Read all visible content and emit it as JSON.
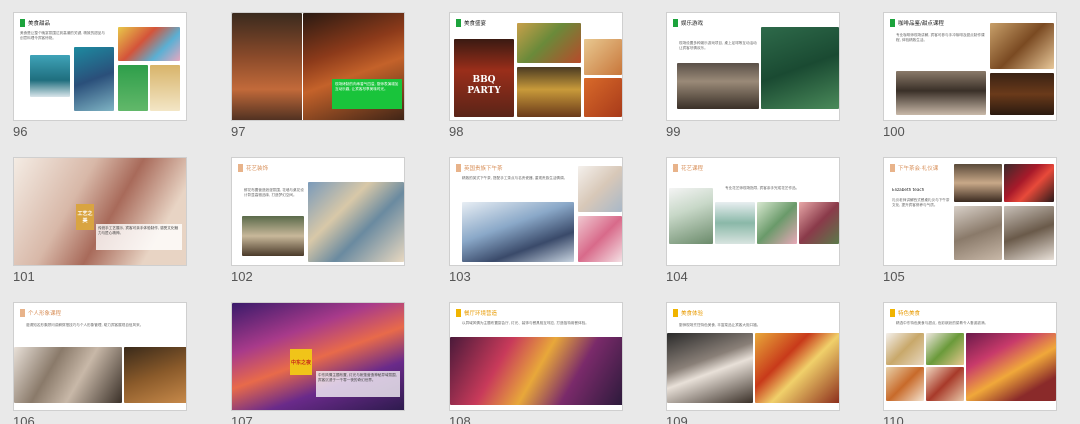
{
  "slides": [
    {
      "number": "96",
      "title": "美食甜品",
      "accent": "#1ca33c",
      "body": "美食是让整个晚宴氛围达到高潮的关键, 精致的甜品与创意料理令宾客惊艳。"
    },
    {
      "number": "97",
      "title": "",
      "accent": "#19c43b",
      "body": "现场烤制的肉串香气四溢, 厨师表演增加互动乐趣, 让宾客尽享美味时光。"
    },
    {
      "number": "98",
      "title": "美食盛宴",
      "accent": "#1ca33c",
      "body": "",
      "badge": "BBQ PARTY"
    },
    {
      "number": "99",
      "title": "娱乐游戏",
      "accent": "#1ca33c",
      "body": "现场设置多种娱乐游戏项目, 桌上足球等互动活动让宾客尽情欢乐。"
    },
    {
      "number": "100",
      "title": "咖啡品鉴/甜点课程",
      "accent": "#1ca33c",
      "body": "专业咖啡师现场讲解, 宾客可参与手冲咖啡及甜点制作课程, 体验精致生活。"
    },
    {
      "number": "101",
      "title": "",
      "accent": "#d9a441",
      "body": "传统手工艺展示, 宾客可亲手体验制作, 感受文化魅力与匠心精神。",
      "badge": "工艺之美"
    },
    {
      "number": "102",
      "title": "花艺装饰",
      "accent": "#e8b38a",
      "body": "鲜花布置营造浪漫氛围, 花墙与桌花设计彰显高雅品味, 打造梦幻空间。"
    },
    {
      "number": "103",
      "title": "英国贵族下午茶",
      "accent": "#e8b38a",
      "body": "精致的英式下午茶, 搭配手工茶点与名贵瓷器, 重现贵族生活情调。"
    },
    {
      "number": "104",
      "title": "花艺课程",
      "accent": "#e8b38a",
      "body": "专业花艺师现场指导, 宾客亲手完成花艺作品。"
    },
    {
      "number": "105",
      "title": "下午茶会·礼仪课",
      "accent": "#e8b38a",
      "body": "礼仪老师讲解西式餐桌礼仪与下午茶文化, 提升宾客修养与气质。",
      "subtitle": "Elizabeth teach"
    },
    {
      "number": "106",
      "title": "个人形象课程",
      "accent": "#e8b38a",
      "body": "邀请知名形象顾问讲解穿搭技巧与个人形象管理, 助力宾客展现自信风采。"
    },
    {
      "number": "107",
      "title": "",
      "accent": "#f0c419",
      "body": "中东风情主题布置, 灯光与帐篷营造神秘异域氛围, 宾客沉浸于一千零一夜的奇幻世界。",
      "badge": "中东之夜"
    },
    {
      "number": "108",
      "title": "餐厅环境营造",
      "accent": "#f0b400",
      "body": "以异域风情为主题布置宴会厅, 灯光、装饰与餐具相互呼应, 打造独特用餐体验。"
    },
    {
      "number": "109",
      "title": "美食体验",
      "accent": "#f0b400",
      "body": "厨师现场烹饪特色美食, 丰富菜品让宾客大饱口福。"
    },
    {
      "number": "110",
      "title": "特色美食",
      "accent": "#f0b400",
      "body": "精选中东特色美食与甜点, 色彩缤纷的菜肴令人垂涎欲滴。"
    }
  ]
}
